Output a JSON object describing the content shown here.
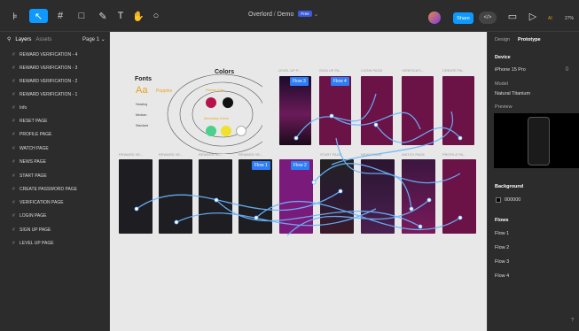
{
  "toolbar": {
    "file_name": "Overlord",
    "project": "Demo",
    "draft_badge": "Free",
    "share_label": "Share",
    "dev_mode_label": "</>",
    "ai_label": "AI",
    "zoom": "27%"
  },
  "left_panel": {
    "tabs": [
      "Layers",
      "Assets"
    ],
    "page": "Page 1",
    "layers": [
      "REWARD VERIFICATION - 4",
      "REWARD VERIFICATION - 3",
      "REWARD VERIFICATION - 2",
      "REWARD VERIFICATION - 1",
      "Info",
      "RESET PAGE",
      "PROFILE PAGE",
      "WATCH PAGE",
      "NEWS PAGE",
      "START PAGE",
      "CREATE PASSWORD PAGE",
      "VERIFICATION PAGE",
      "LOGIN PAGE",
      "SIGN UP PAGE",
      "LEVEL UP PAGE"
    ]
  },
  "canvas": {
    "style_board": {
      "fonts_title": "Fonts",
      "colors_title": "Colors",
      "font_sample": "Aa",
      "font_name": "Poppins",
      "rows": [
        "Heading",
        "Medium",
        "Standard"
      ],
      "primary_label": "Primary Color",
      "secondary_label": "Secondary Colors",
      "swatch_colors": [
        "#b5124e",
        "#111111",
        "#4bd18c",
        "#f0e12b",
        "#ffffff"
      ]
    },
    "top_labels": [
      "LEVEL UP P...",
      "SIGN UP PA...",
      "LOGIN PAGE",
      "VERIFICATI...",
      "CREATE PA..."
    ],
    "bottom_labels": [
      "REWARD VE...",
      "REWARD VE...",
      "REWARD VE...",
      "REWARD VE...",
      "START PAGE",
      "NEWS PAGE",
      "WATCH PAGE",
      "PROFILE PA...",
      "RESET PAGE"
    ],
    "flows": [
      "Flow 3",
      "Flow 4",
      "Flow 1",
      "Flow 2"
    ]
  },
  "right_panel": {
    "tabs": [
      "Design",
      "Prototype"
    ],
    "device_title": "Device",
    "device": "iPhone 15 Pro",
    "model_label": "Model",
    "model": "Natural Titanium",
    "preview_label": "Preview",
    "background_title": "Background",
    "background_hex": "000000",
    "flows_title": "Flows",
    "flows": [
      "Flow 1",
      "Flow 2",
      "Flow 3",
      "Flow 4"
    ]
  }
}
